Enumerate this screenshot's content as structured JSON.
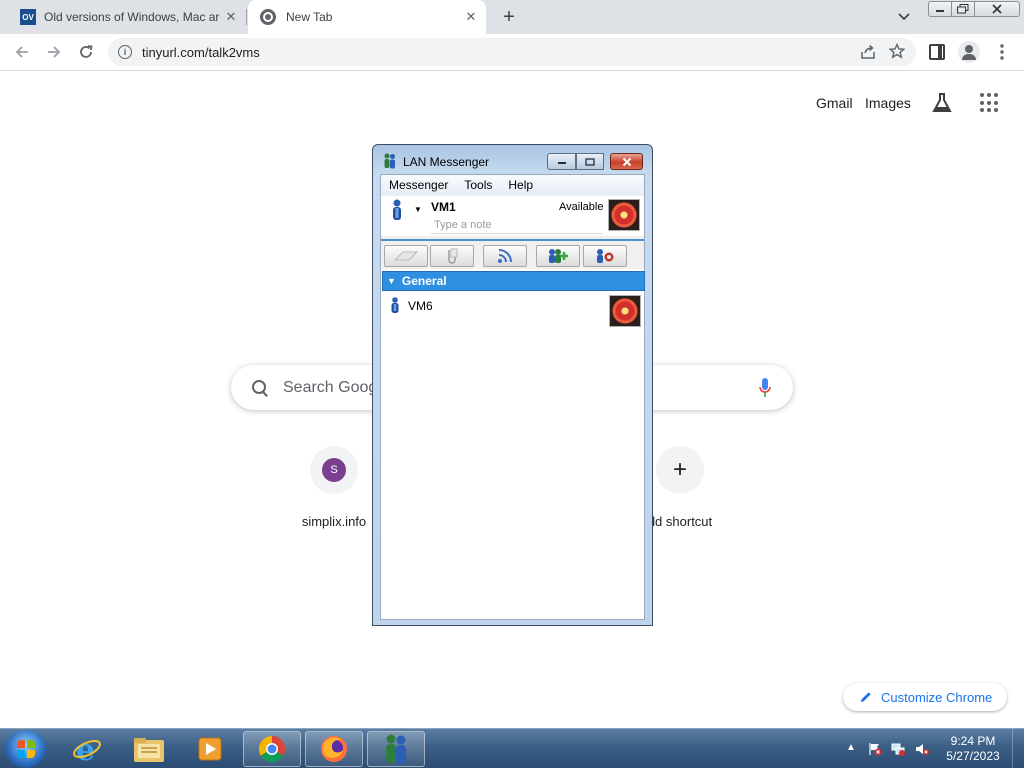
{
  "browser": {
    "tabs": [
      {
        "favicon": "OV",
        "title": "Old versions of Windows, Mac ar",
        "active": false
      },
      {
        "favicon": "chrome-icon",
        "title": "New Tab",
        "active": true
      }
    ],
    "new_tab_symbol": "+",
    "close_symbol": "✕",
    "url": "tinyurl.com/talk2vms"
  },
  "ntp": {
    "gmail": "Gmail",
    "images": "Images",
    "search_placeholder": "Search Goog",
    "shortcuts": [
      {
        "letter": "S",
        "label": "simplix.info"
      },
      {
        "symbol": "+",
        "label": "dd shortcut"
      }
    ],
    "customize_label": "Customize Chrome"
  },
  "lan": {
    "title": "LAN Messenger",
    "menu": [
      "Messenger",
      "Tools",
      "Help"
    ],
    "username": "VM1",
    "status": "Available",
    "note_placeholder": "Type a note",
    "group": "General",
    "contact": "VM6"
  },
  "taskbar": {
    "time": "9:24 PM",
    "date": "5/27/2023"
  },
  "colors": {
    "accent": "#1a73e8",
    "group_header": "#2f8fe0",
    "taskbar": "#3c5f86"
  }
}
